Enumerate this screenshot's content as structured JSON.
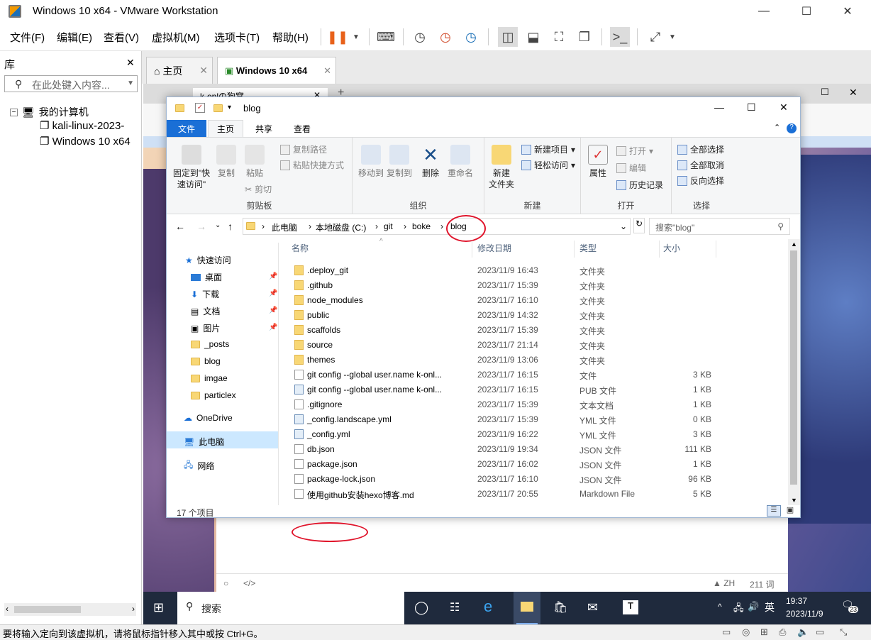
{
  "window": {
    "title": "Windows 10 x64 - VMware Workstation"
  },
  "menu": [
    "文件(F)",
    "编辑(E)",
    "查看(V)",
    "虚拟机(M)",
    "选项卡(T)",
    "帮助(H)"
  ],
  "library": {
    "title": "库",
    "search_placeholder": "在此处键入内容...",
    "root": "我的计算机",
    "items": [
      "kali-linux-2023-",
      "Windows 10 x64"
    ]
  },
  "vm_tabs": [
    {
      "label": "主页"
    },
    {
      "label": "Windows 10 x64"
    }
  ],
  "browser_tab": "k-onlの狗窝",
  "explorer": {
    "title": "blog",
    "ribbon_tabs": [
      "文件",
      "主页",
      "共享",
      "查看"
    ],
    "groups": {
      "clipboard": {
        "label": "剪贴板",
        "pin": "固定到\"快速访问\"",
        "copy": "复制",
        "paste": "粘贴",
        "copy_path": "复制路径",
        "paste_shortcut": "粘贴快捷方式",
        "cut": "剪切"
      },
      "organize": {
        "label": "组织",
        "move": "移动到",
        "copyto": "复制到",
        "delete": "删除",
        "rename": "重命名"
      },
      "new": {
        "label": "新建",
        "folder": "新建\n文件夹",
        "item": "新建项目",
        "easy": "轻松访问"
      },
      "open": {
        "label": "打开",
        "props": "属性",
        "open": "打开",
        "edit": "编辑",
        "history": "历史记录"
      },
      "select": {
        "label": "选择",
        "all": "全部选择",
        "none": "全部取消",
        "invert": "反向选择"
      }
    },
    "breadcrumb": [
      "此电脑",
      "本地磁盘 (C:)",
      "git",
      "boke",
      "blog"
    ],
    "search_placeholder": "搜索\"blog\"",
    "nav": {
      "quick": "快速访问",
      "desktop": "桌面",
      "downloads": "下载",
      "docs": "文档",
      "pictures": "图片",
      "posts": "_posts",
      "blog": "blog",
      "imgae": "imgae",
      "particlex": "particlex",
      "onedrive": "OneDrive",
      "pc": "此电脑",
      "network": "网络"
    },
    "columns": {
      "name": "名称",
      "date": "修改日期",
      "type": "类型",
      "size": "大小"
    },
    "files": [
      {
        "name": ".deploy_git",
        "date": "2023/11/9 16:43",
        "type": "文件夹",
        "size": "",
        "icon": "fold"
      },
      {
        "name": ".github",
        "date": "2023/11/7 15:39",
        "type": "文件夹",
        "size": "",
        "icon": "fold"
      },
      {
        "name": "node_modules",
        "date": "2023/11/7 16:10",
        "type": "文件夹",
        "size": "",
        "icon": "fold"
      },
      {
        "name": "public",
        "date": "2023/11/9 14:32",
        "type": "文件夹",
        "size": "",
        "icon": "fold"
      },
      {
        "name": "scaffolds",
        "date": "2023/11/7 15:39",
        "type": "文件夹",
        "size": "",
        "icon": "fold"
      },
      {
        "name": "source",
        "date": "2023/11/7 21:14",
        "type": "文件夹",
        "size": "",
        "icon": "fold"
      },
      {
        "name": "themes",
        "date": "2023/11/9 13:06",
        "type": "文件夹",
        "size": "",
        "icon": "fold"
      },
      {
        "name": "git config --global user.name    k-onl...",
        "date": "2023/11/7 16:15",
        "type": "文件",
        "size": "3 KB",
        "icon": "doc"
      },
      {
        "name": "git config --global user.name    k-onl...",
        "date": "2023/11/7 16:15",
        "type": "PUB 文件",
        "size": "1 KB",
        "icon": "pub"
      },
      {
        "name": ".gitignore",
        "date": "2023/11/7 15:39",
        "type": "文本文档",
        "size": "1 KB",
        "icon": "doc"
      },
      {
        "name": "_config.landscape.yml",
        "date": "2023/11/7 15:39",
        "type": "YML 文件",
        "size": "0 KB",
        "icon": "pub"
      },
      {
        "name": "_config.yml",
        "date": "2023/11/9 16:22",
        "type": "YML 文件",
        "size": "3 KB",
        "icon": "pub"
      },
      {
        "name": "db.json",
        "date": "2023/11/9 19:34",
        "type": "JSON 文件",
        "size": "111 KB",
        "icon": "doc"
      },
      {
        "name": "package.json",
        "date": "2023/11/7 16:02",
        "type": "JSON 文件",
        "size": "1 KB",
        "icon": "doc"
      },
      {
        "name": "package-lock.json",
        "date": "2023/11/7 16:10",
        "type": "JSON 文件",
        "size": "96 KB",
        "icon": "doc"
      },
      {
        "name": "使用github安装hexo博客.md",
        "date": "2023/11/7 20:55",
        "type": "Markdown File",
        "size": "5 KB",
        "icon": "doc"
      }
    ],
    "status": "17 个项目"
  },
  "edge_status": {
    "lang": "ZH",
    "count": "211 词"
  },
  "taskbar": {
    "search": "搜索",
    "time": "19:37",
    "date": "2023/11/9",
    "ime": "英",
    "notif": "23"
  },
  "statusbar": "要将输入定向到该虚拟机，请将鼠标指针移入其中或按 Ctrl+G。"
}
